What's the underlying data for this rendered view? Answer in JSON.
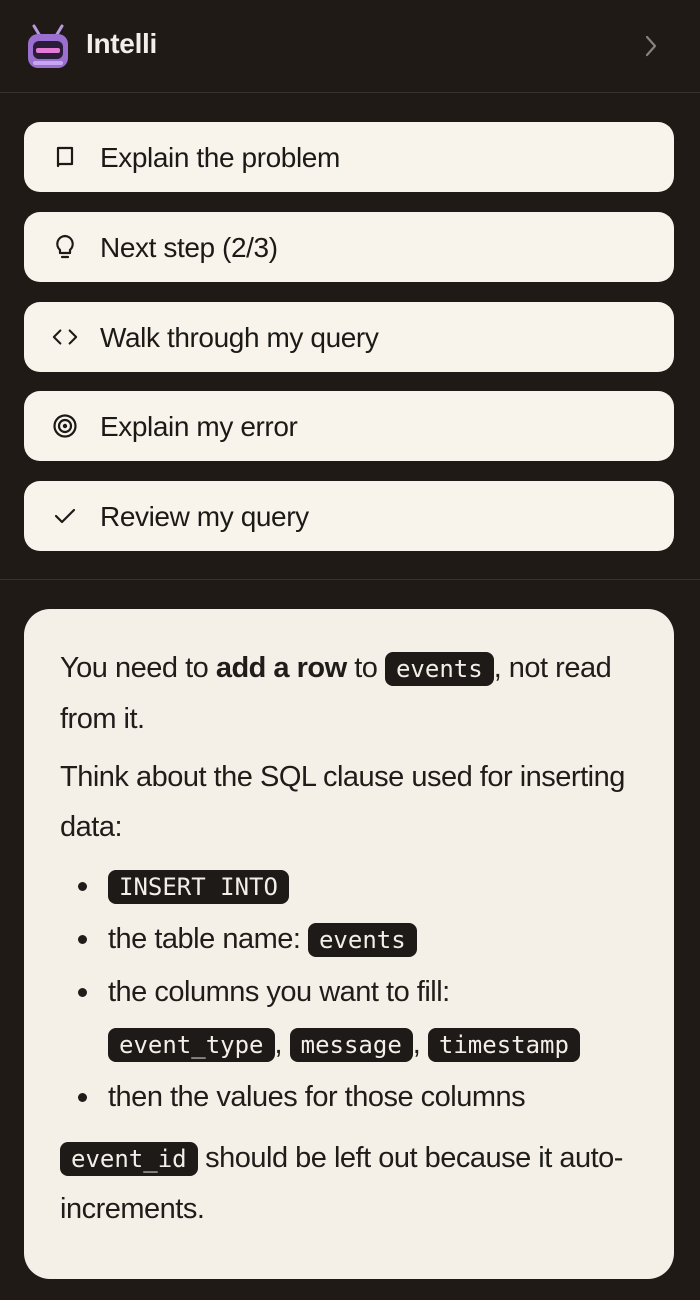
{
  "header": {
    "title": "Intelli",
    "logo_icon": "robot-mascot-icon",
    "collapse_icon": "chevron-right-icon"
  },
  "actions": [
    {
      "label": "Explain the problem",
      "icon": "book-icon"
    },
    {
      "label": "Next step (2/3)",
      "icon": "lightbulb-icon"
    },
    {
      "label": "Walk through my query",
      "icon": "code-brackets-icon"
    },
    {
      "label": "Explain my error",
      "icon": "target-icon"
    },
    {
      "label": "Review my query",
      "icon": "checkmark-icon"
    }
  ],
  "response": {
    "p1_before": "You need to ",
    "p1_bold": "add a row",
    "p1_mid": " to ",
    "p1_code": "events",
    "p1_after": ", not read from it.",
    "p2": "Think about the SQL clause used for inserting data:",
    "bullet1_code": "INSERT INTO",
    "bullet2_text": "the table name: ",
    "bullet2_code": "events",
    "bullet3_text": "the columns you want to fill:",
    "bullet3_code1": "event_type",
    "bullet3_code2": "message",
    "bullet3_code3": "timestamp",
    "bullet3_sep": ",",
    "bullet4_text": "then the values for those columns",
    "p3_code": "event_id",
    "p3_text": " should be left out because it auto-increments."
  },
  "colors": {
    "background": "#1f1a16",
    "button_bg": "#f8f4ec",
    "card_bg": "#f4f0e8",
    "code_bg": "#1d1a17",
    "logo_purple": "#9b6fd0"
  }
}
